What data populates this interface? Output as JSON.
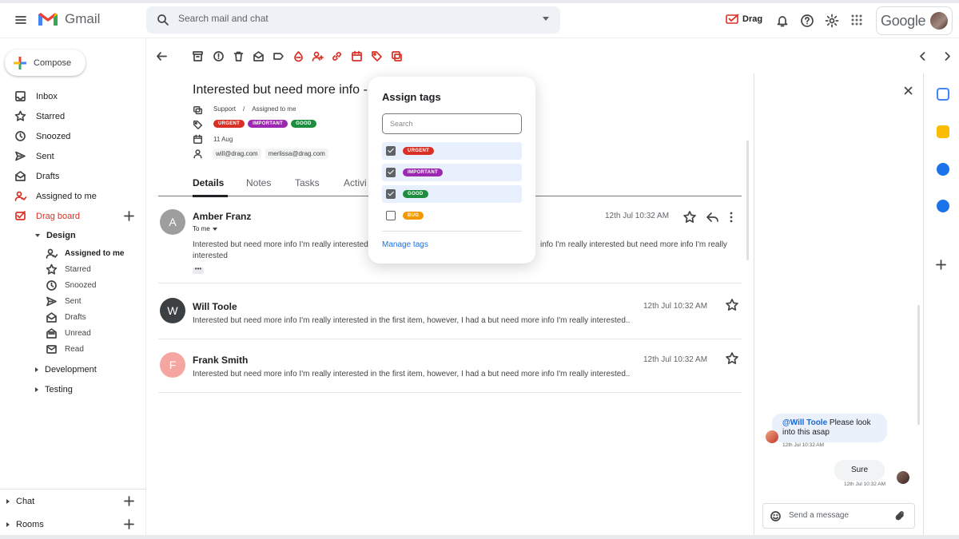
{
  "app": {
    "logo_text": "Gmail",
    "google_text": "Google",
    "drag_brand": "Drag"
  },
  "search": {
    "placeholder": "Search mail and chat"
  },
  "sidebar": {
    "compose_label": "Compose",
    "items": [
      {
        "label": "Inbox",
        "icon": "inbox-icon"
      },
      {
        "label": "Starred",
        "icon": "star-icon"
      },
      {
        "label": "Snoozed",
        "icon": "clock-icon"
      },
      {
        "label": "Sent",
        "icon": "send-icon"
      },
      {
        "label": "Drafts",
        "icon": "draft-icon"
      },
      {
        "label": "Assigned to me",
        "icon": "assigned-icon"
      },
      {
        "label": "Drag board",
        "icon": "drag-board-icon"
      }
    ],
    "design": {
      "label": "Design",
      "items": [
        {
          "label": "Assigned to me"
        },
        {
          "label": "Starred"
        },
        {
          "label": "Snoozed"
        },
        {
          "label": "Sent"
        },
        {
          "label": "Drafts"
        },
        {
          "label": "Unread"
        },
        {
          "label": "Read"
        }
      ]
    },
    "collapsed": [
      {
        "label": "Development"
      },
      {
        "label": "Testing"
      }
    ],
    "bottom": [
      {
        "label": "Chat"
      },
      {
        "label": "Rooms"
      }
    ]
  },
  "email": {
    "subject": "Interested but need more info - Le",
    "breadcrumb": [
      "Support",
      "/",
      "Assigned to me"
    ],
    "tags": [
      "URGENT",
      "IMPORTANT",
      "GOOD"
    ],
    "date": "11 Aug",
    "participants": [
      "will@drag.com",
      "merlissa@drag.com"
    ],
    "tabs": [
      "Details",
      "Notes",
      "Tasks",
      "Activi"
    ]
  },
  "messages": [
    {
      "initial": "A",
      "sender": "Amber Franz",
      "to": "To me",
      "date": "12th Jul 10:32 AM",
      "snippet_left": "Interested but need more info I'm really interested",
      "snippet_right": "info I'm really interested but need more info I'm really",
      "snippet_line2": "interested",
      "avatar_color": "#9e9e9e"
    },
    {
      "initial": "W",
      "sender": "Will Toole",
      "date": "12th Jul 10:32 AM",
      "snippet": "Interested but need more info I'm really interested in the first item, however, I had a but need more info I'm really interested..",
      "avatar_color": "#3c4043"
    },
    {
      "initial": "F",
      "sender": "Frank Smith",
      "date": "12th Jul 10:32 AM",
      "snippet": "Interested but need more info I'm really interested in the first item, however, I had a but need more info I'm really interested..",
      "avatar_color": "#f6a6a0"
    }
  ],
  "tag_popup": {
    "title": "Assign tags",
    "search_placeholder": "Search",
    "tags": [
      {
        "label": "URGENT",
        "checked": true,
        "color": "#d93025"
      },
      {
        "label": "IMPORTANT",
        "checked": true,
        "color": "#9c27b0"
      },
      {
        "label": "GOOD",
        "checked": true,
        "color": "#1e8e3e"
      },
      {
        "label": "BUG",
        "checked": false,
        "color": "#f29900"
      }
    ],
    "manage_label": "Manage tags"
  },
  "chat": {
    "messages": [
      {
        "mention": "@Will Toole",
        "text": " Please look into this asap",
        "time": "12th Jul 10:32 AM"
      },
      {
        "text": "Sure",
        "time": "12th Jul 10:32 AM"
      }
    ],
    "input_placeholder": "Send a message"
  }
}
